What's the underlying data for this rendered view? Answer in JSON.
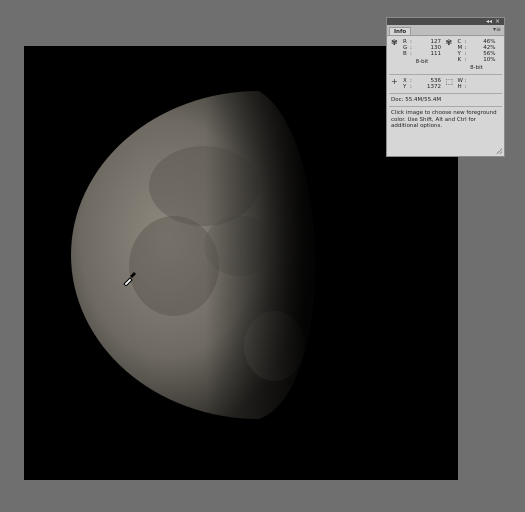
{
  "canvas": {
    "background": "#000000",
    "moon_tint": "#8f8a80"
  },
  "info_panel": {
    "tab_label": "Info",
    "strip_controls": [
      "◂◂",
      "×"
    ],
    "menu_icon": "▾≡",
    "rgb": [
      {
        "label": "R",
        "value": "127"
      },
      {
        "label": "G",
        "value": "130"
      },
      {
        "label": "B",
        "value": "111"
      }
    ],
    "rgb_bits": "8-bit",
    "cmyk": [
      {
        "label": "C",
        "value": "46%"
      },
      {
        "label": "M",
        "value": "42%"
      },
      {
        "label": "Y",
        "value": "56%"
      },
      {
        "label": "K",
        "value": "10%"
      }
    ],
    "cmyk_bits": "8-bit",
    "position": [
      {
        "label": "X",
        "value": "536"
      },
      {
        "label": "Y",
        "value": "1372"
      }
    ],
    "size": [
      {
        "label": "W",
        "value": ""
      },
      {
        "label": "H",
        "value": ""
      }
    ],
    "doc": "Doc: 55.4M/55.4M",
    "help": "Click image to choose new foreground color.  Use Shift, Alt and Ctrl for additional options."
  }
}
